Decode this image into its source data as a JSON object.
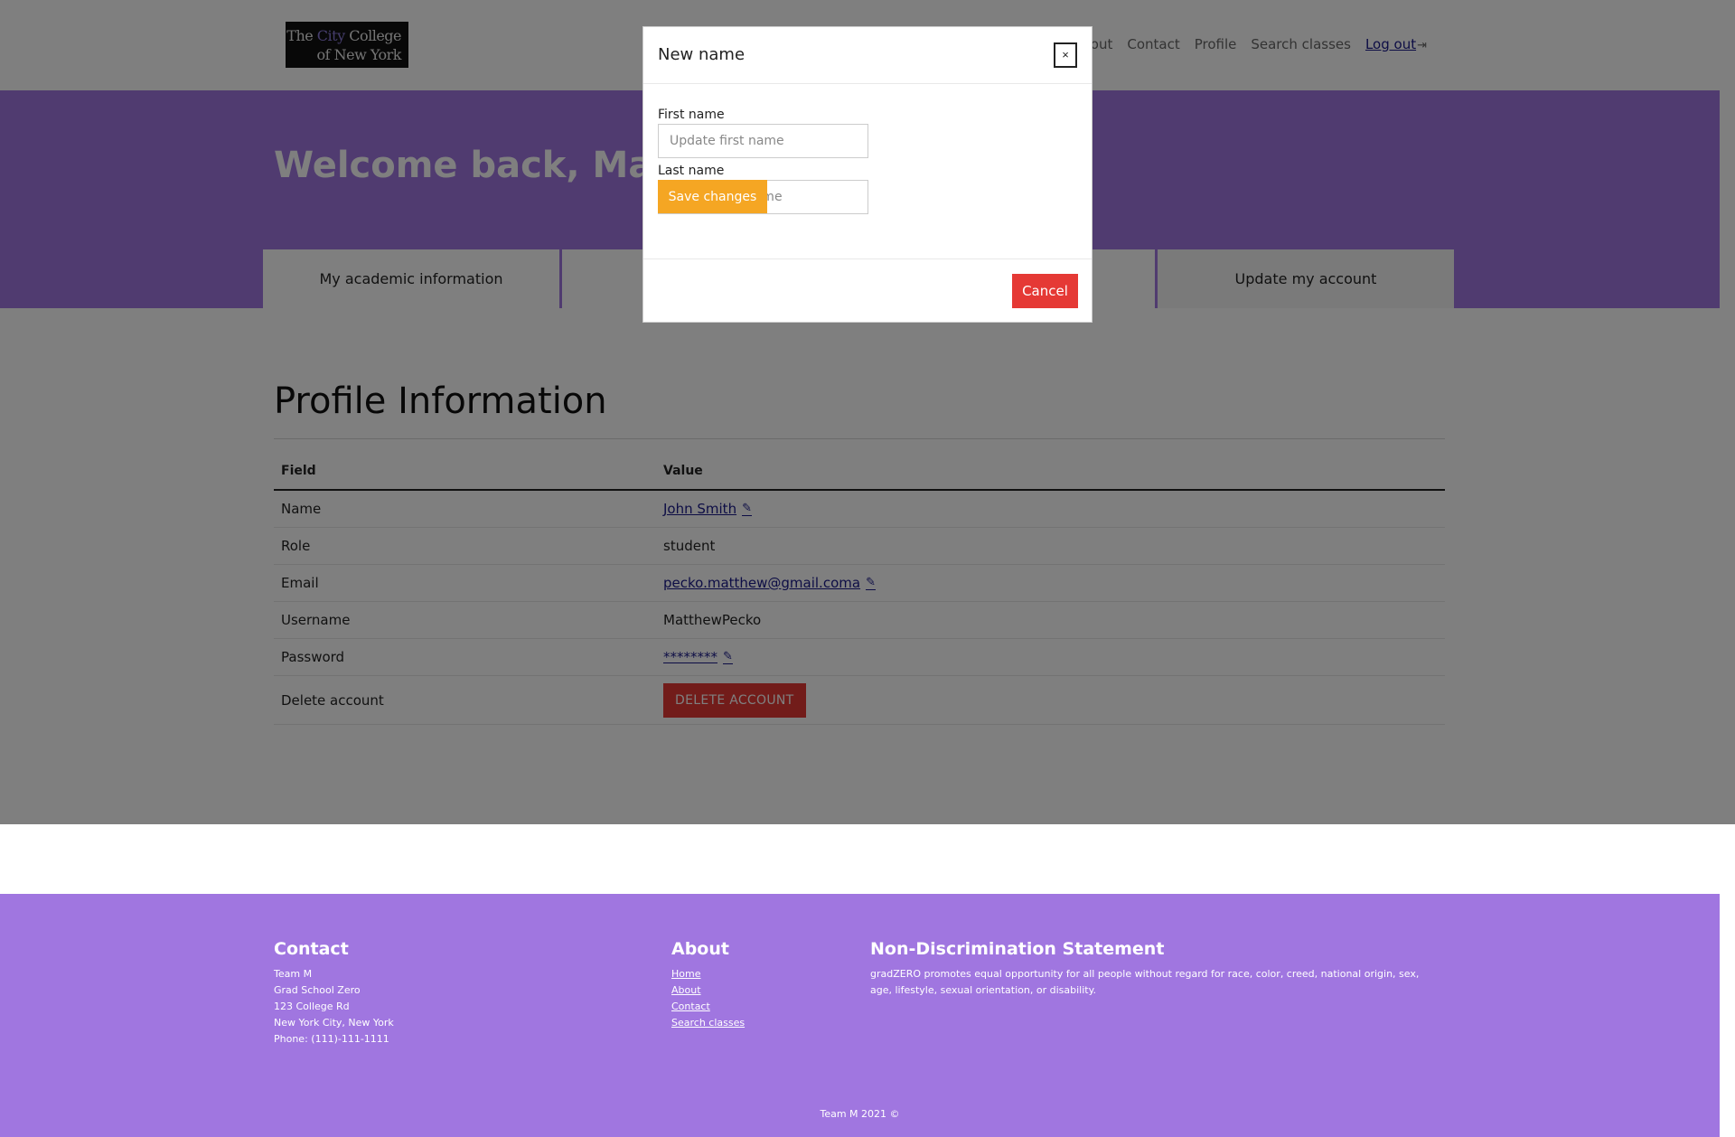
{
  "logo": {
    "line1_part1": "The ",
    "line1_accent": "City",
    "line1_part2": " College",
    "line2": "of New York"
  },
  "nav": {
    "items": [
      "About",
      "Contact",
      "Profile",
      "Search classes"
    ],
    "logout": "Log out",
    "logout_icon": "logout-icon"
  },
  "hero": {
    "welcome": "Welcome back, Matthew",
    "tabs": [
      "My academic information",
      "",
      "Update my account"
    ]
  },
  "profile": {
    "title": "Profile Information",
    "columns": [
      "Field",
      "Value"
    ],
    "rows": [
      {
        "field": "Name",
        "value": "John Smith"
      },
      {
        "field": "Role",
        "value": "student"
      },
      {
        "field": "Email",
        "value": "pecko.matthew@gmail.coma"
      },
      {
        "field": "Username",
        "value": "MatthewPecko"
      },
      {
        "field": "Password",
        "value": "********"
      },
      {
        "field": "Delete account",
        "value": "DELETE ACCOUNT"
      }
    ]
  },
  "footer": {
    "contact": {
      "title": "Contact",
      "lines": [
        "Team M",
        "Grad School Zero",
        "123 College Rd",
        "New York City, New York",
        "Phone: (111)-111-1111"
      ]
    },
    "about": {
      "title": "About",
      "links": [
        "Home",
        "About",
        "Contact",
        "Search classes"
      ]
    },
    "nondiscrimination": {
      "title": "Non-Discrimination Statement",
      "text": "gradZERO promotes equal opportunity for all people without regard for race, color, creed, national origin, sex, age, lifestyle, sexual orientation, or disability."
    },
    "copyright": "Team M 2021 ©"
  },
  "modal": {
    "title": "New name",
    "close": "×",
    "first_label": "First name",
    "first_placeholder": "Update first name",
    "last_label": "Last name",
    "last_placeholder": "Update last name",
    "save": "Save changes",
    "cancel": "Cancel"
  },
  "colors": {
    "purple": "#a076e0",
    "save": "#f5a623",
    "danger": "#e53935",
    "link": "#1a1a8a"
  }
}
